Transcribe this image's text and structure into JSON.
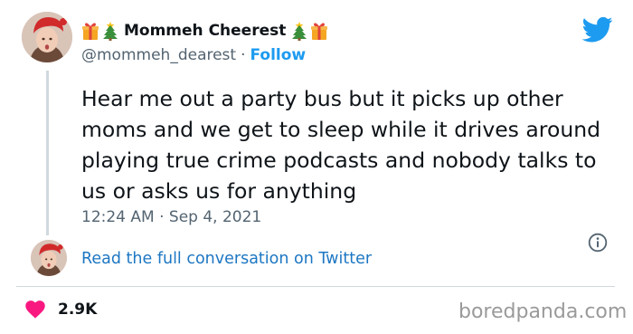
{
  "author": {
    "display_name": "Mommeh Cheerest",
    "handle": "@mommeh_dearest",
    "separator": "·",
    "follow_label": "Follow"
  },
  "tweet": {
    "text": "Hear me out a party bus but it picks up other moms and we get to sleep while it drives around playing true crime podcasts and nobody talks to us or asks us for anything",
    "timestamp": "12:24 AM · Sep 4, 2021"
  },
  "conversation_link": "Read the full conversation on Twitter",
  "engagement": {
    "likes": "2.9K"
  },
  "watermark": "boredpanda.com",
  "icons": {
    "brand": "twitter-bird-icon",
    "info": "info-icon",
    "like": "heart-icon",
    "emoji_left": [
      "gift-icon",
      "christmas-tree-icon"
    ],
    "emoji_right": [
      "christmas-tree-icon",
      "gift-icon"
    ]
  },
  "colors": {
    "twitter_blue": "#1d9bf0",
    "link_blue": "#1d77c3",
    "heart": "#f91880",
    "text_secondary": "#536471",
    "divider": "#cfd9de"
  }
}
